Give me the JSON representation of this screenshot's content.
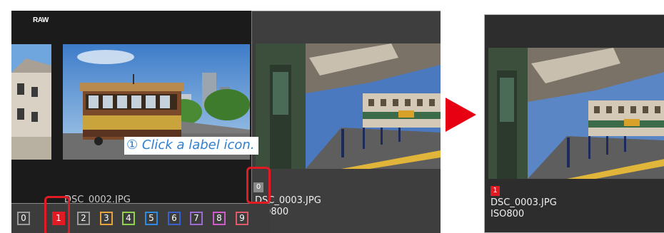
{
  "left_view": {
    "raw_badge": "RAW",
    "center_filename": "DSC_0002.JPG",
    "right_label_value": "0",
    "right_filename": "DSC_0003.JPG",
    "right_iso": "ISO800"
  },
  "callout": "① Click a label icon.",
  "label_picker": [
    {
      "num": "0",
      "color": "#9a9a9a"
    },
    {
      "num": "1",
      "color": "#e01b24"
    },
    {
      "num": "2",
      "color": "#9a9a9a"
    },
    {
      "num": "3",
      "color": "#e6a23c"
    },
    {
      "num": "4",
      "color": "#8fd14f"
    },
    {
      "num": "5",
      "color": "#2f8be0"
    },
    {
      "num": "6",
      "color": "#3a62c8"
    },
    {
      "num": "7",
      "color": "#9b6bd2"
    },
    {
      "num": "8",
      "color": "#d15ac9"
    },
    {
      "num": "9",
      "color": "#e05b6a"
    }
  ],
  "result_view": {
    "label_value": "1",
    "filename": "DSC_0003.JPG",
    "iso": "ISO800"
  },
  "colors": {
    "highlight": "#e01b24",
    "arrow": "#e60012",
    "callout_text": "#2f7fd0"
  }
}
